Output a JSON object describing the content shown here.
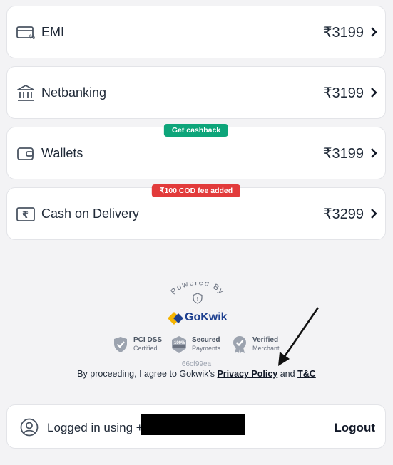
{
  "payment_methods": [
    {
      "label": "EMI",
      "price": "₹3199",
      "icon": "credit-card-percent-icon"
    },
    {
      "label": "Netbanking",
      "price": "₹3199",
      "icon": "bank-icon"
    },
    {
      "label": "Wallets",
      "price": "₹3199",
      "icon": "wallet-icon",
      "badge": "Get cashback",
      "badge_color": "#0ea57a"
    },
    {
      "label": "Cash on Delivery",
      "price": "₹3299",
      "icon": "rupee-note-icon",
      "badge": "₹100 COD fee added",
      "badge_color": "#e23b3b"
    }
  ],
  "footer": {
    "powered_by": "Powered By",
    "brand": "GoKwik",
    "trust_badges": [
      {
        "title": "PCI DSS",
        "subtitle": "Certified",
        "icon": "shield-check-icon"
      },
      {
        "title": "Secured",
        "subtitle": "Payments",
        "icon": "secure-100-badge-icon"
      },
      {
        "title": "Verified",
        "subtitle": "Merchant",
        "icon": "verified-badge-icon"
      }
    ],
    "hash": "66cf99ea",
    "consent_prefix": "By proceeding, I agree to Gokwik's",
    "privacy_policy": "Privacy Policy",
    "and": "and",
    "tnc": "T&C"
  },
  "login": {
    "text": "Logged in using +9",
    "logout": "Logout"
  },
  "colors": {
    "brand_blue": "#1d3f8f",
    "brand_yellow": "#f5b400",
    "green": "#0ea57a",
    "red": "#e23b3b"
  }
}
